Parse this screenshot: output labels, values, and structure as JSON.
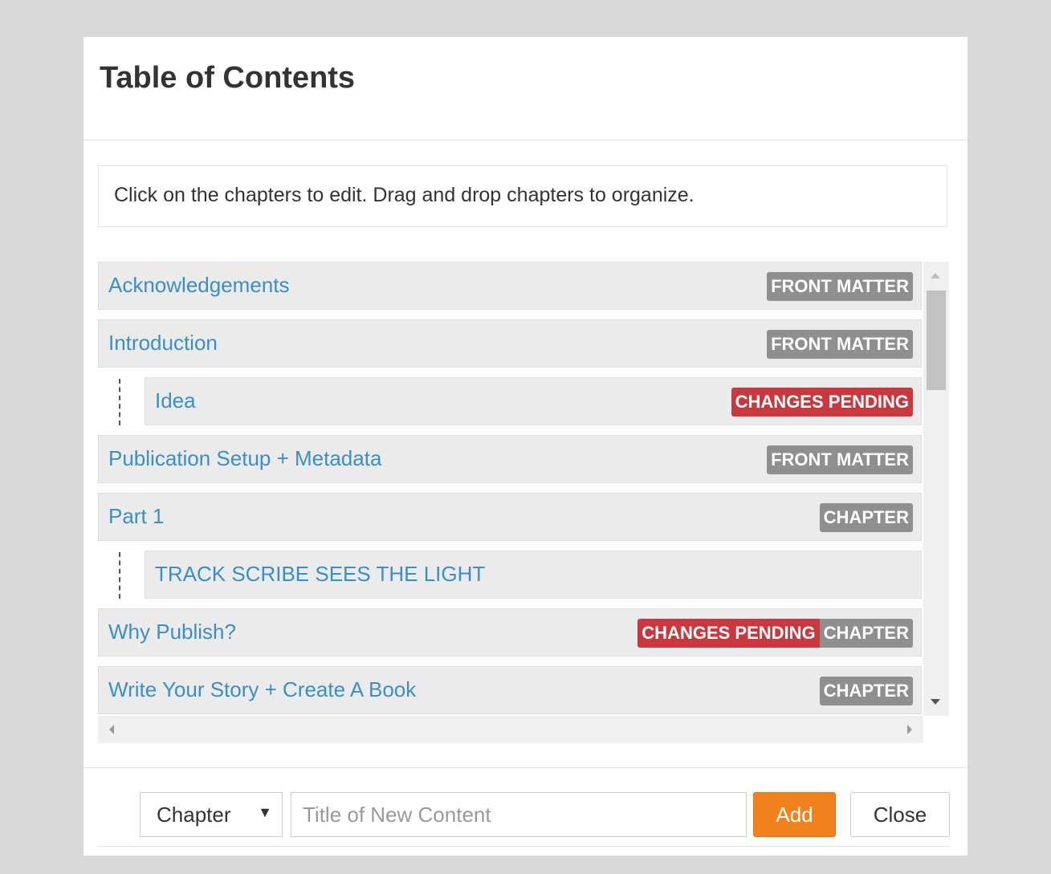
{
  "modal": {
    "title": "Table of Contents",
    "help_text": "Click on the chapters to edit. Drag and drop chapters to organize."
  },
  "toc": {
    "items": [
      {
        "label": "Acknowledgements",
        "badges": [
          {
            "text": "FRONT MATTER",
            "color": "#8f8f8f"
          }
        ],
        "indent": 0
      },
      {
        "label": "Introduction",
        "badges": [
          {
            "text": "FRONT MATTER",
            "color": "#8f8f8f"
          }
        ],
        "indent": 0
      },
      {
        "label": "Idea",
        "badges": [
          {
            "text": "CHANGES PENDING",
            "color": "#c8383e"
          }
        ],
        "indent": 1
      },
      {
        "label": "Publication Setup + Metadata",
        "badges": [
          {
            "text": "FRONT MATTER",
            "color": "#8f8f8f"
          }
        ],
        "indent": 0
      },
      {
        "label": "Part 1",
        "badges": [
          {
            "text": "CHAPTER",
            "color": "#8f8f8f"
          }
        ],
        "indent": 0
      },
      {
        "label": "TRACK SCRIBE SEES THE LIGHT",
        "badges": [],
        "indent": 1
      },
      {
        "label": "Why Publish?",
        "badges": [
          {
            "text": "CHANGES PENDING",
            "color": "#c8383e"
          },
          {
            "text": "CHAPTER",
            "color": "#8f8f8f"
          }
        ],
        "indent": 0
      },
      {
        "label": "Write Your Story + Create A Book",
        "badges": [
          {
            "text": "CHAPTER",
            "color": "#8f8f8f"
          }
        ],
        "indent": 0
      }
    ]
  },
  "footer": {
    "type_select": {
      "value": "Chapter",
      "caret": "▼"
    },
    "title_input": {
      "value": "",
      "placeholder": "Title of New Content"
    },
    "add_label": "Add",
    "close_label": "Close"
  },
  "colors": {
    "link": "#3a8fc8",
    "badge_gray": "#8f8f8f",
    "badge_red": "#c8383e",
    "add_button": "#f0811d"
  }
}
